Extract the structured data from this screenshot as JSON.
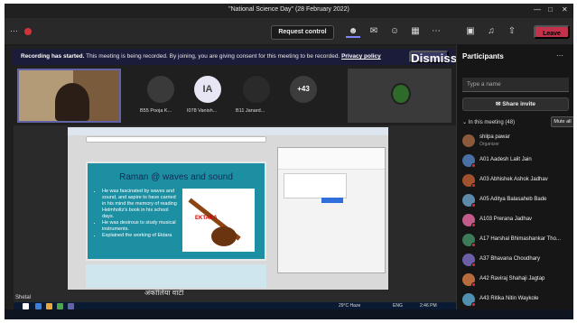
{
  "window": {
    "title": "\"National Science Day\" (28 February 2022)"
  },
  "toolbar": {
    "request_control_label": "Request control",
    "leave_label": "Leave",
    "icons": [
      "people-icon",
      "chat-icon",
      "reactions-icon",
      "rooms-icon",
      "more-icon",
      "camera-icon",
      "mic-icon",
      "share-icon"
    ]
  },
  "banner": {
    "title": "Recording has started.",
    "message": "This meeting is being recorded. By joining, you are giving consent for this meeting to be recorded.",
    "policy_link": "Privacy policy",
    "dismiss_label": "Dismiss"
  },
  "gallery": {
    "tiles": [
      {
        "initials": "",
        "label": "B55 Pooja K...",
        "color": "#3a3a3a"
      },
      {
        "initials": "IA",
        "label": "I078 Vanish...",
        "color": "#e6e6f5"
      },
      {
        "initials": "",
        "label": "B11 Janard...",
        "color": "#2a2a2a"
      },
      {
        "initials": "+43",
        "label": "",
        "color": "#3c3c3c"
      }
    ]
  },
  "shared_screen": {
    "slide_title": "Raman @ waves and sound",
    "bullets": [
      "He was fascinated by waves and sound, and aspire to have carried in his mind the memory of reading Helmholtz's book in his school days.",
      "He was desirous to study musical instruments.",
      "Explained the working of Ektara"
    ],
    "image_label": "EKTARA",
    "hindi_text": "अंकोलिया वाटी",
    "presenter_label": "Shetal"
  },
  "participants": {
    "title": "Participants",
    "invite_placeholder": "Type a name",
    "share_invite_label": "Share invite",
    "section_label": "In this meeting (48)",
    "mute_all_label": "Mute all",
    "people": [
      {
        "name": "shilpa pawar",
        "role": "Organizer",
        "color": "#8b5a3c",
        "muted": false
      },
      {
        "name": "A01 Aadesh Lalit Jain",
        "role": "",
        "color": "#4a6fa5",
        "muted": true
      },
      {
        "name": "A03 Abhishek Ashok Jadhav",
        "role": "",
        "color": "#a0522d",
        "muted": true
      },
      {
        "name": "A05 Aditya Balasaheb Bade",
        "role": "",
        "color": "#5d8aa8",
        "muted": true
      },
      {
        "name": "A103 Prerana Jadhav",
        "role": "",
        "color": "#c25b8a",
        "muted": true
      },
      {
        "name": "A17 Harshal Bhimashankar Tho...",
        "role": "",
        "color": "#3d7a5a",
        "muted": true
      },
      {
        "name": "A37 Bhavana Choudhary",
        "role": "",
        "color": "#6b5fa8",
        "muted": true
      },
      {
        "name": "A42 Raviraj Shahaji Jagtap",
        "role": "",
        "color": "#b86b3c",
        "muted": true
      },
      {
        "name": "A43 Ritika Nitin Waykole",
        "role": "",
        "color": "#4f8fb0",
        "muted": true
      }
    ]
  },
  "taskbar": {
    "weather": "29°C Haze",
    "lang": "ENG",
    "time": "2:46 PM"
  }
}
